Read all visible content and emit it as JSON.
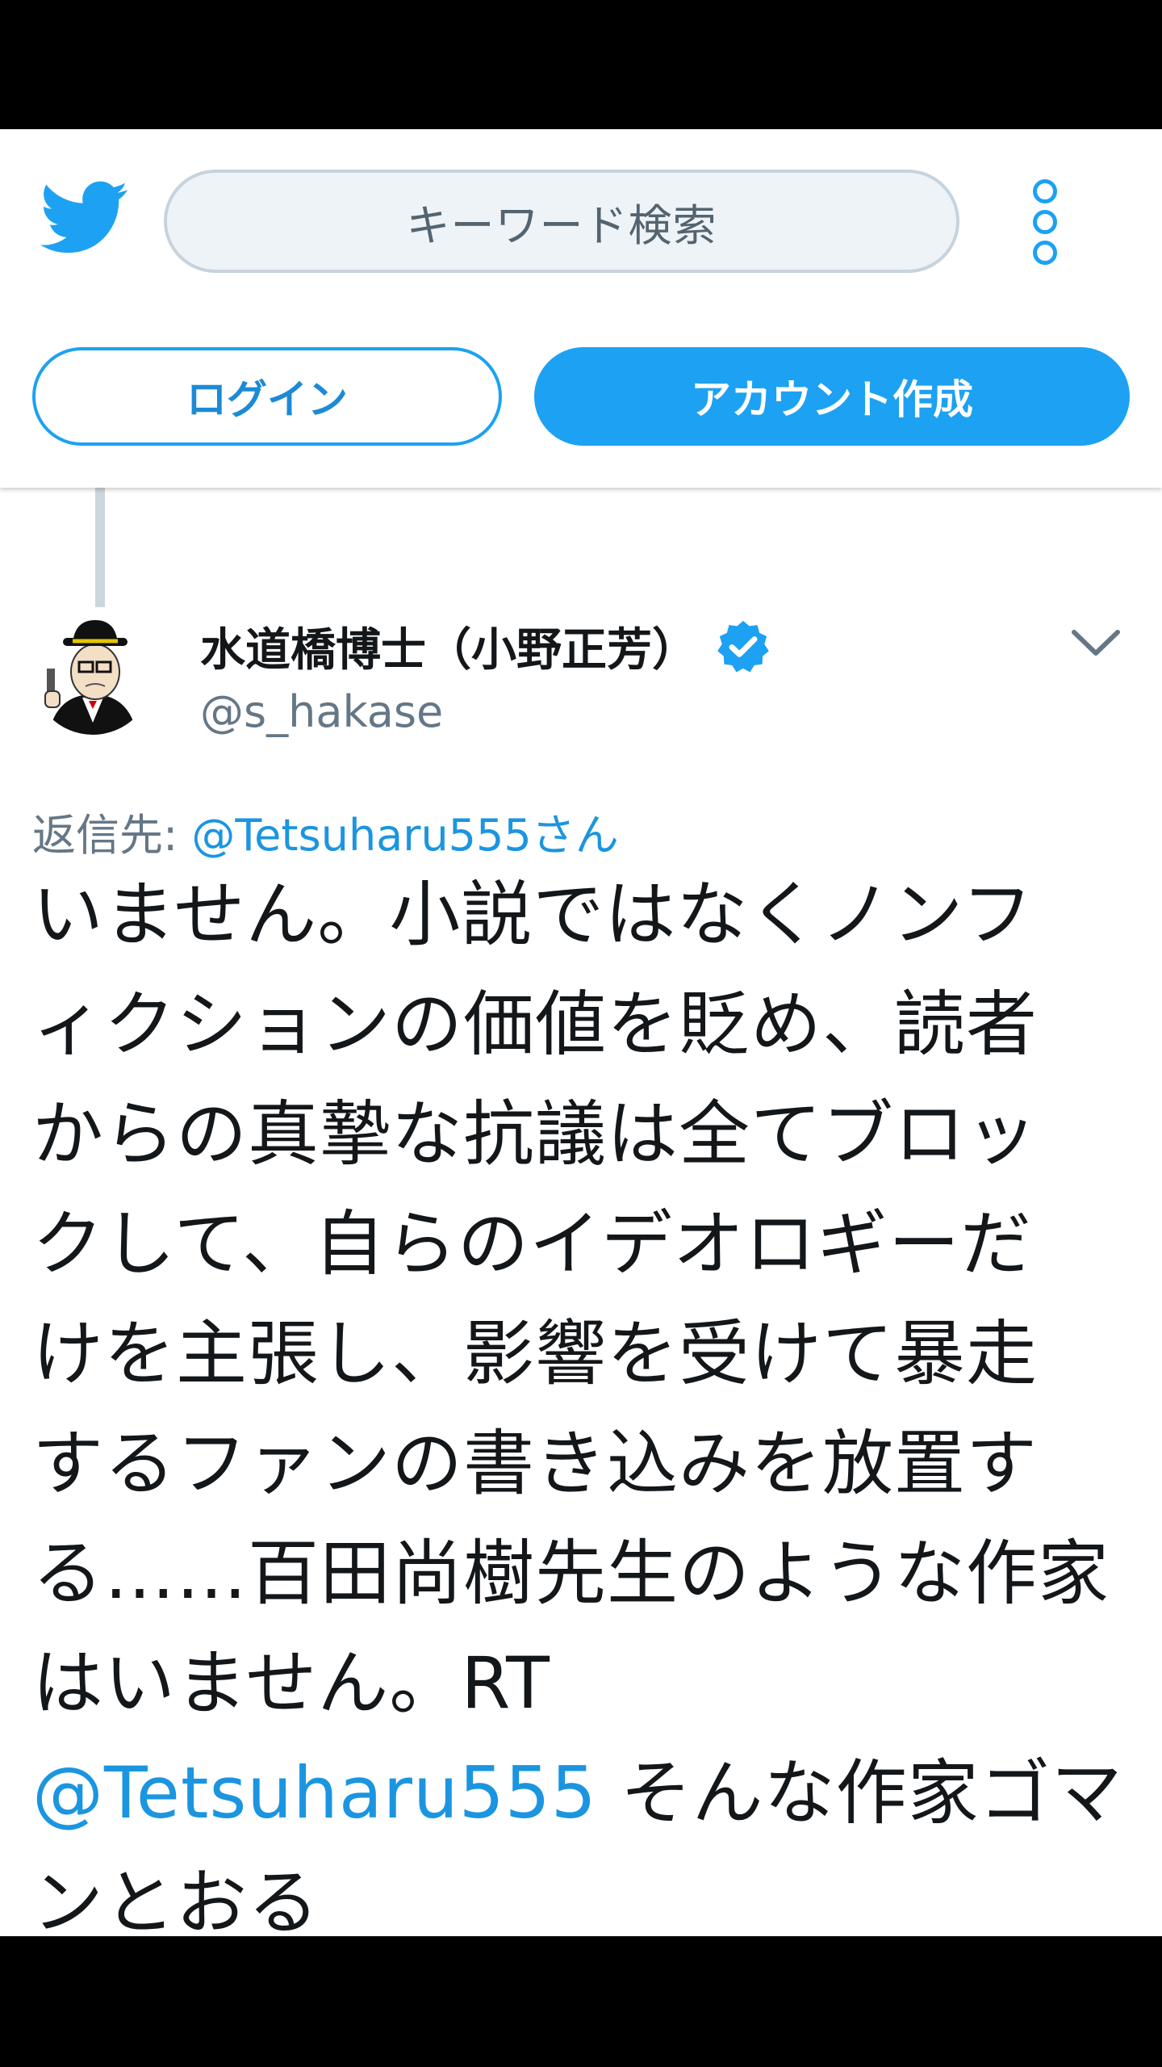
{
  "header": {
    "search_placeholder": "キーワード検索",
    "login_label": "ログイン",
    "signup_label": "アカウント作成",
    "icons": [
      "twitter-bird-icon",
      "more-vertical-icon"
    ]
  },
  "tweet": {
    "display_name": "水道橋博士（小野正芳）",
    "username": "@s_hakase",
    "verified": true,
    "reply_to_prefix": "返信先:",
    "reply_to_mention": "@Tetsuharu555さん",
    "text_lines": [
      "いません。小説ではなくノンフ",
      "ィクションの価値を貶め、読者",
      "からの真摯な抗議は全てブロッ",
      "クして、自らのイデオロギーだ",
      "けを主張し、影響を受けて暴走",
      "するファンの書き込みを放置す",
      "る……百田尚樹先生のような作家",
      "はいません。RT"
    ],
    "quote_mention": "@Tetsuharu555",
    "quote_text": " そんな作家ゴマ",
    "last_line_partial": "ンとおる"
  },
  "colors": {
    "brand_blue": "#1da1f2",
    "link_blue": "#1b95e0",
    "text_primary": "#14171a",
    "text_secondary": "#657786"
  }
}
